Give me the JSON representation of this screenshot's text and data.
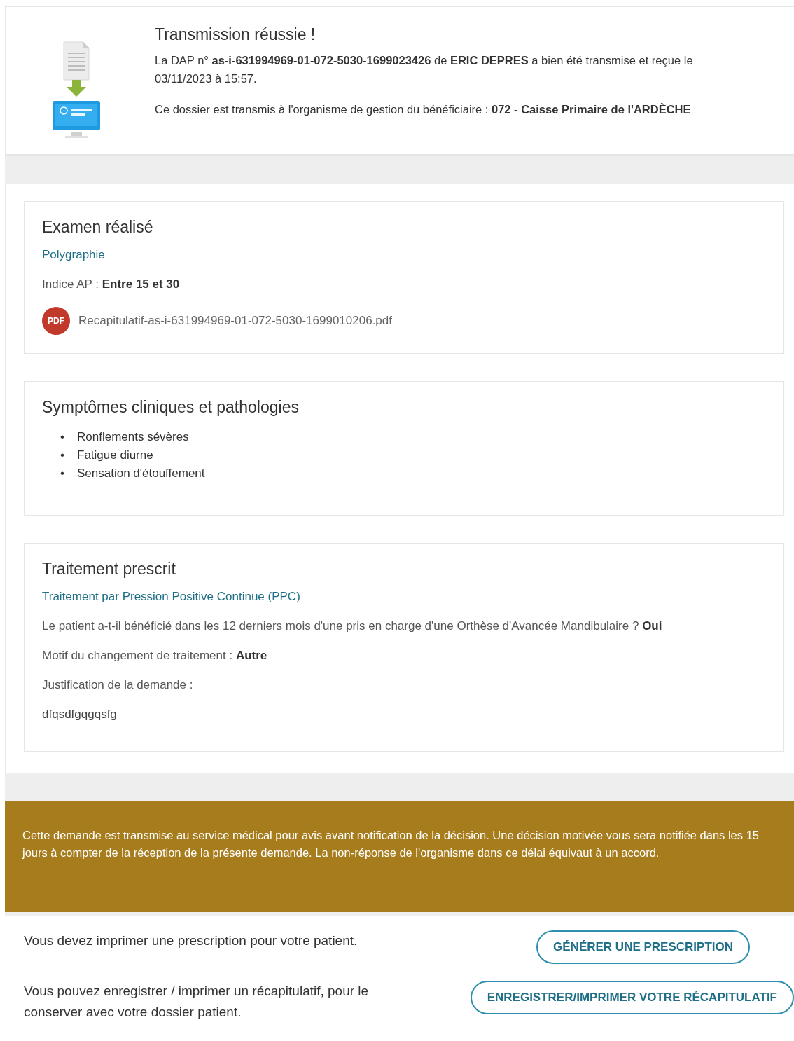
{
  "confirmation": {
    "title": "Transmission réussie !",
    "message": "La DAP n° **as-i-631994969-01-072-5030-1699023426** de **ERIC DEPRES** a bien été transmise et reçue le 03/11/2023 à 15:57.",
    "destination": "Ce dossier est transmis à l'organisme de gestion du bénéficiaire : **072 - Caisse Primaire de l'ARDÈCHE**"
  },
  "sections": [
    {
      "title": "Examen réalisé",
      "items": [
        {
          "kind": "link",
          "text": "Polygraphie"
        },
        {
          "kind": "field",
          "label": "Indice AP :",
          "value": "Entre 15 et 30"
        },
        {
          "kind": "file",
          "badge": "PDF",
          "text": "Recapitulatif-as-i-631994969-01-072-5030-1699010206.pdf"
        }
      ]
    },
    {
      "title": "Symptômes cliniques et pathologies",
      "items": [
        {
          "kind": "bullets",
          "marker": "•",
          "entries": [
            "Ronflements sévères",
            "Fatigue diurne",
            "Sensation d'étouffement"
          ]
        }
      ]
    },
    {
      "title": "Traitement prescrit",
      "items": [
        {
          "kind": "link",
          "text": "Traitement par Pression Positive Continue (PPC)"
        },
        {
          "kind": "field",
          "label": "Le patient a-t-il bénéficié dans les 12 derniers mois d'une pris en charge d'une Orthèse d'Avancée Mandibulaire ?",
          "value": "Oui"
        },
        {
          "kind": "field",
          "label": "Motif du changement de traitement :",
          "value": "Autre"
        },
        {
          "kind": "field",
          "label": "Justification de la demande :"
        },
        {
          "kind": "text",
          "text": "dfqsdfgqgqsfg"
        }
      ]
    }
  ],
  "notice": "Cette demande est transmise au service médical pour avis avant notification de la décision. Une décision motivée vous sera notifiée dans les 15 jours à compter de la réception de la présente demande. La non-réponse de l'organisme dans ce délai équivaut à un accord.",
  "actions": [
    {
      "text": "Vous devez imprimer une prescription pour votre patient.",
      "button": "GÉNÉRER UNE PRESCRIPTION"
    },
    {
      "text": "Vous pouvez enregistrer / imprimer un récapitulatif, pour le conserver avec votre dossier patient.",
      "button": "ENREGISTRER/IMPRIMER VOTRE RÉCAPITULATIF"
    }
  ]
}
